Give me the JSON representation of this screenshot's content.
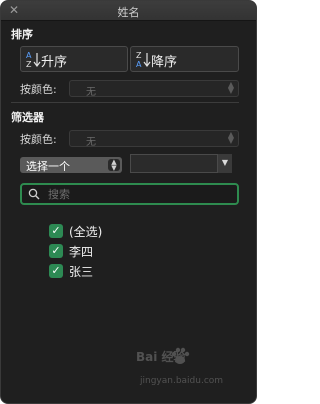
{
  "window": {
    "title": "姓名"
  },
  "sort": {
    "heading": "排序",
    "ascending_label": "升序",
    "descending_label": "降序",
    "by_color_label": "按颜色:",
    "by_color_value": "无"
  },
  "filter": {
    "heading": "筛选器",
    "by_color_label": "按颜色:",
    "by_color_value": "无",
    "condition_select": "选择一个",
    "search_placeholder": "搜索",
    "items": [
      {
        "label": "(全选)",
        "checked": true
      },
      {
        "label": "李四",
        "checked": true
      },
      {
        "label": "张三",
        "checked": true
      }
    ]
  },
  "watermark": {
    "brand": "Bai 经验",
    "url": "jingyan.baidu.com"
  },
  "colors": {
    "accent": "#2e8b4f",
    "checkbox": "#2d8a54",
    "panel": "#1f1f1f"
  }
}
